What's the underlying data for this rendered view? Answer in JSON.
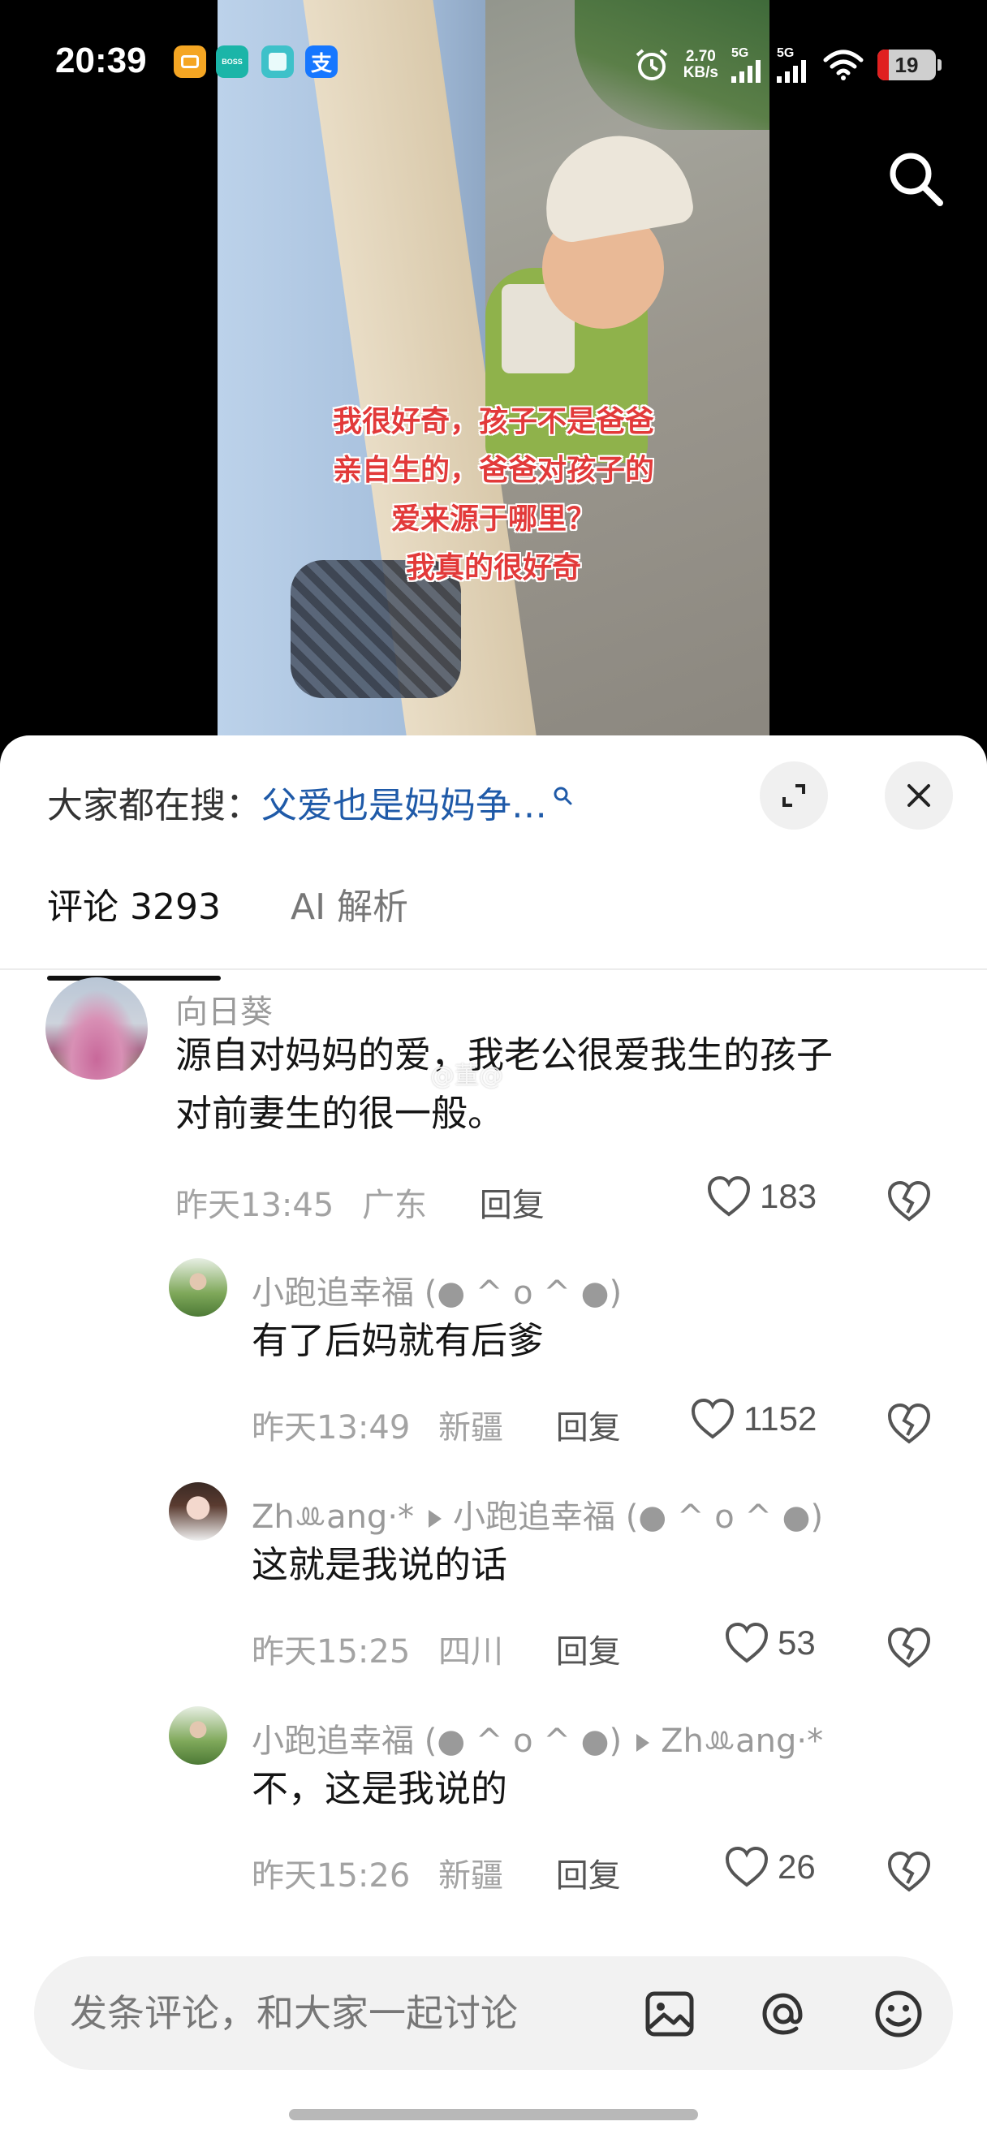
{
  "status_bar": {
    "time": "20:39",
    "net_speed_value": "2.70",
    "net_speed_unit": "KB/s",
    "signal_1": "5G",
    "signal_2": "5G",
    "battery_level": "19",
    "battery_color": "#e02020",
    "app_icons": [
      {
        "name": "orange-app-icon",
        "color": "#f5a623"
      },
      {
        "name": "boss-app-icon",
        "text": "BOSS",
        "color": "#1bb5a8"
      },
      {
        "name": "teal-app-icon",
        "color": "#3ec1c9"
      },
      {
        "name": "alipay-icon",
        "text": "支",
        "color": "#1677ff"
      }
    ]
  },
  "video": {
    "caption": [
      "我很好奇，孩子不是爸爸",
      "亲自生的，爸爸对孩子的",
      "爱来源于哪里？",
      "我真的很好奇"
    ],
    "caption_color": "#e23a3a",
    "search_icon": "search-icon"
  },
  "hot_search": {
    "label": "大家都在搜：",
    "query": "父爱也是妈妈争…",
    "query_color": "#1f5aa8"
  },
  "tabs": [
    {
      "label": "评论 3293",
      "active": true
    },
    {
      "label": "AI 解析",
      "active": false
    }
  ],
  "comments": [
    {
      "name": "向日葵",
      "text_lines": [
        "源自对妈妈的爱，我老公很爱我生的孩子",
        "对前妻生的很一般。"
      ],
      "time": "昨天13:45",
      "location": "广东",
      "reply_label": "回复",
      "likes": "183"
    },
    {
      "name": "小跑追幸福 (● ^ o ^ ●)",
      "text": "有了后妈就有后爹",
      "time": "昨天13:49",
      "location": "新疆",
      "reply_label": "回复",
      "likes": "1152"
    },
    {
      "name": "Zhꔛang·*",
      "reply_to": "小跑追幸福 (● ^ o ^ ●)",
      "text": "这就是我说的话",
      "time": "昨天15:25",
      "location": "四川",
      "reply_label": "回复",
      "likes": "53"
    },
    {
      "name": "小跑追幸福 (● ^ o ^ ●)",
      "reply_to": "Zhꔛang·*",
      "text": "不，这是我说的",
      "time": "昨天15:26",
      "location": "新疆",
      "reply_label": "回复",
      "likes": "26"
    }
  ],
  "watermark": "@董@",
  "input": {
    "placeholder": "发条评论，和大家一起讨论"
  }
}
